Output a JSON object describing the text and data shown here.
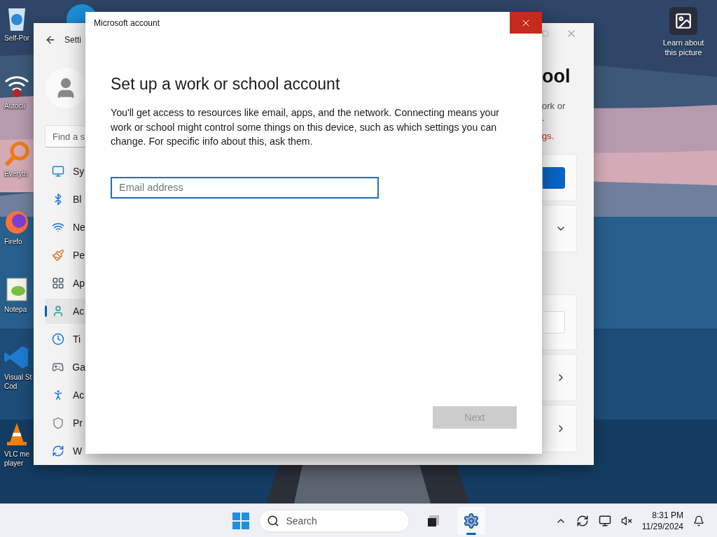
{
  "desktop_icons": [
    {
      "kind": "recycle",
      "label": "Self-Por"
    },
    {
      "kind": "wifi",
      "label": "Autocli"
    },
    {
      "kind": "search",
      "label": "Everyth"
    },
    {
      "kind": "firefox",
      "label": "Firefo"
    },
    {
      "kind": "notepad",
      "label": "Notepa"
    },
    {
      "kind": "vscode",
      "label": "Visual St\nCod"
    },
    {
      "kind": "vlc",
      "label": "VLC me\nplayer"
    }
  ],
  "wallpaper_info": {
    "label": "Learn about this picture"
  },
  "settings_window": {
    "title": "Setti",
    "search": {
      "placeholder": "Find a s"
    },
    "nav": [
      {
        "kind": "system",
        "label": "Sy",
        "selected": false
      },
      {
        "kind": "bluetooth",
        "label": "Bl",
        "selected": false
      },
      {
        "kind": "network",
        "label": "Ne",
        "selected": false
      },
      {
        "kind": "personalization",
        "label": "Pe",
        "selected": false
      },
      {
        "kind": "apps",
        "label": "Ap",
        "selected": false
      },
      {
        "kind": "accounts",
        "label": "Ac",
        "selected": true
      },
      {
        "kind": "time",
        "label": "Ti",
        "selected": false
      },
      {
        "kind": "gaming",
        "label": "Ga",
        "selected": false
      },
      {
        "kind": "accessibility",
        "label": "Ac",
        "selected": false
      },
      {
        "kind": "privacy",
        "label": "Pr",
        "selected": false
      },
      {
        "kind": "update",
        "label": "W",
        "selected": false
      }
    ],
    "heading": "ool",
    "text_lines": [
      "ork or",
      "."
    ],
    "link": "gs.",
    "cards": [
      {
        "kind": "button"
      },
      {
        "kind": "dropdown"
      },
      {
        "kind": "field"
      },
      {
        "kind": "link"
      },
      {
        "kind": "link"
      }
    ]
  },
  "dialog": {
    "title": "Microsoft account",
    "heading": "Set up a work or school account",
    "body": "You'll get access to resources like email, apps, and the network. Connecting means your work or school might control some things on this device, such as which settings you can change. For specific info about this, ask them.",
    "email": {
      "placeholder": "Email address"
    },
    "next": {
      "label": "Next",
      "disabled": true
    }
  },
  "taskbar": {
    "search": {
      "placeholder": "Search"
    },
    "apps": [
      {
        "kind": "task-view",
        "active": false
      },
      {
        "kind": "settings",
        "active": true
      }
    ],
    "time": "8:31 PM",
    "date": "11/29/2024"
  }
}
